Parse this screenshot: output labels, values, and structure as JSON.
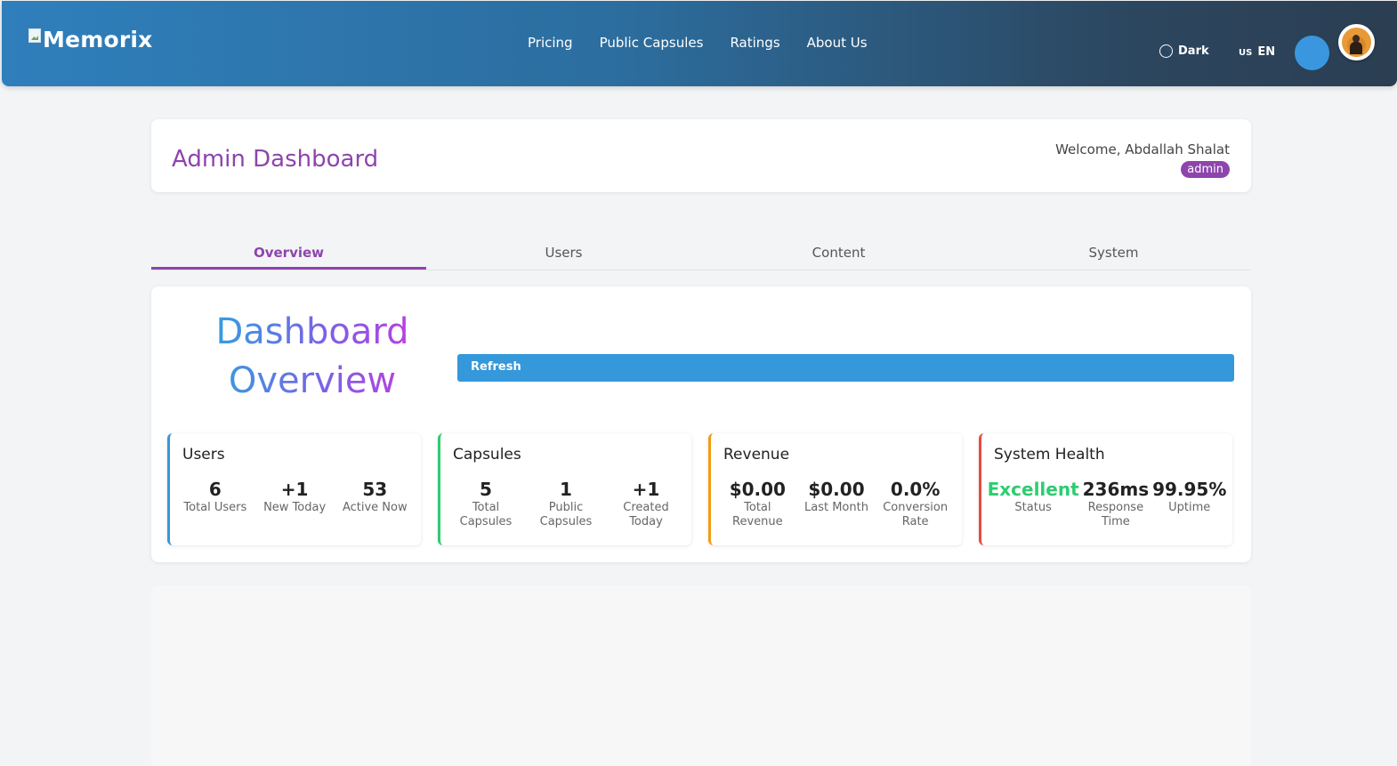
{
  "header": {
    "brand": "Memorix",
    "nav": [
      "Pricing",
      "Public Capsules",
      "Ratings",
      "About Us"
    ],
    "theme_label": "Dark",
    "lang_flag": "US",
    "lang_code": "EN"
  },
  "admin": {
    "title": "Admin Dashboard",
    "welcome": "Welcome, Abdallah Shalat",
    "role": "admin"
  },
  "tabs": [
    {
      "label": "Overview",
      "active": true
    },
    {
      "label": "Users",
      "active": false
    },
    {
      "label": "Content",
      "active": false
    },
    {
      "label": "System",
      "active": false
    }
  ],
  "overview": {
    "title": "Dashboard Overview",
    "refresh_label": "Refresh",
    "cards": {
      "users": {
        "title": "Users",
        "accent": "#3498db",
        "stats": [
          {
            "value": "6",
            "label": "Total Users"
          },
          {
            "value": "+1",
            "label": "New Today"
          },
          {
            "value": "53",
            "label": "Active Now"
          }
        ]
      },
      "capsules": {
        "title": "Capsules",
        "accent": "#2ecc71",
        "stats": [
          {
            "value": "5",
            "label": "Total Capsules"
          },
          {
            "value": "1",
            "label": "Public Capsules"
          },
          {
            "value": "+1",
            "label": "Created Today"
          }
        ]
      },
      "revenue": {
        "title": "Revenue",
        "accent": "#f39c12",
        "stats": [
          {
            "value": "$0.00",
            "label": "Total Revenue"
          },
          {
            "value": "$0.00",
            "label": "Last Month"
          },
          {
            "value": "0.0%",
            "label": "Conversion Rate"
          }
        ]
      },
      "system": {
        "title": "System Health",
        "accent": "#e74c3c",
        "stats": [
          {
            "value": "Excellent",
            "label": "Status"
          },
          {
            "value": "236ms",
            "label": "Response Time"
          },
          {
            "value": "99.95%",
            "label": "Uptime"
          }
        ]
      }
    }
  }
}
